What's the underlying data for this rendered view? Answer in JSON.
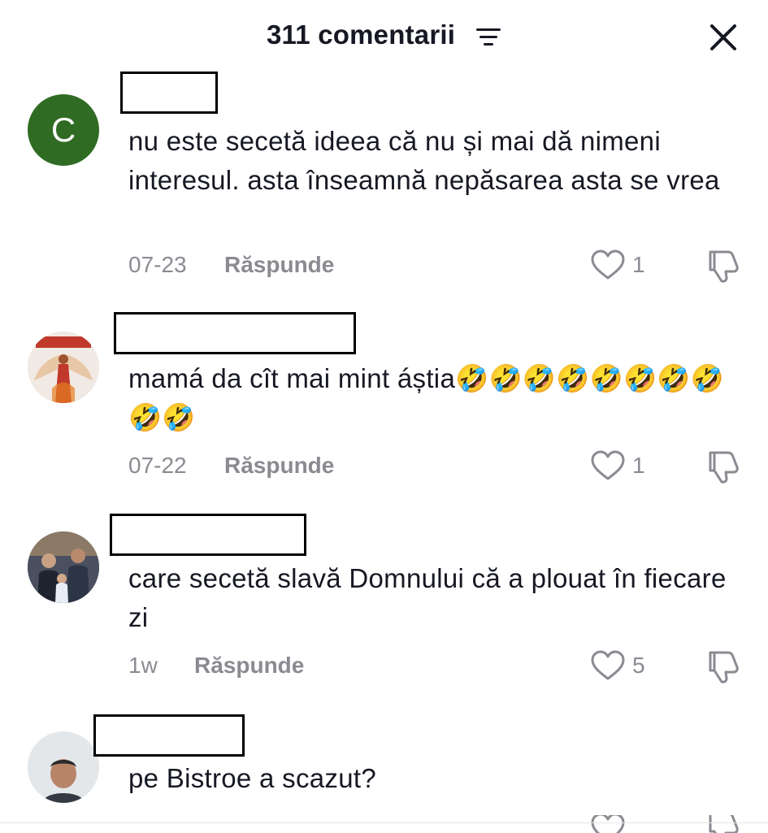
{
  "header": {
    "title": "311 comentarii",
    "sort_icon": "filter-lines-icon",
    "close_icon": "close-icon"
  },
  "colors": {
    "text": "#161823",
    "muted": "#8a8b91",
    "avatar_c": "#2f6b22"
  },
  "comments": [
    {
      "avatar_letter": "C",
      "text": "nu este secetă ideea că nu și mai dă nimeni interesul. asta înseamnă nepăsarea asta se vrea",
      "date": "07-23",
      "reply_label": "Răspunde",
      "likes": "1"
    },
    {
      "avatar_icon": "profile-photo-angel",
      "text": "mamá da cît mai mint áștia🤣🤣🤣🤣🤣🤣🤣🤣🤣🤣",
      "date": "07-22",
      "reply_label": "Răspunde",
      "likes": "1"
    },
    {
      "avatar_icon": "profile-photo-family",
      "text": "care secetă slavă Domnului că a plouat în fiecare zi",
      "date": "1w",
      "reply_label": "Răspunde",
      "likes": "5"
    },
    {
      "avatar_icon": "profile-photo-man",
      "text": "pe Bistroe a scazut?",
      "date": "",
      "reply_label": "",
      "likes": ""
    }
  ]
}
